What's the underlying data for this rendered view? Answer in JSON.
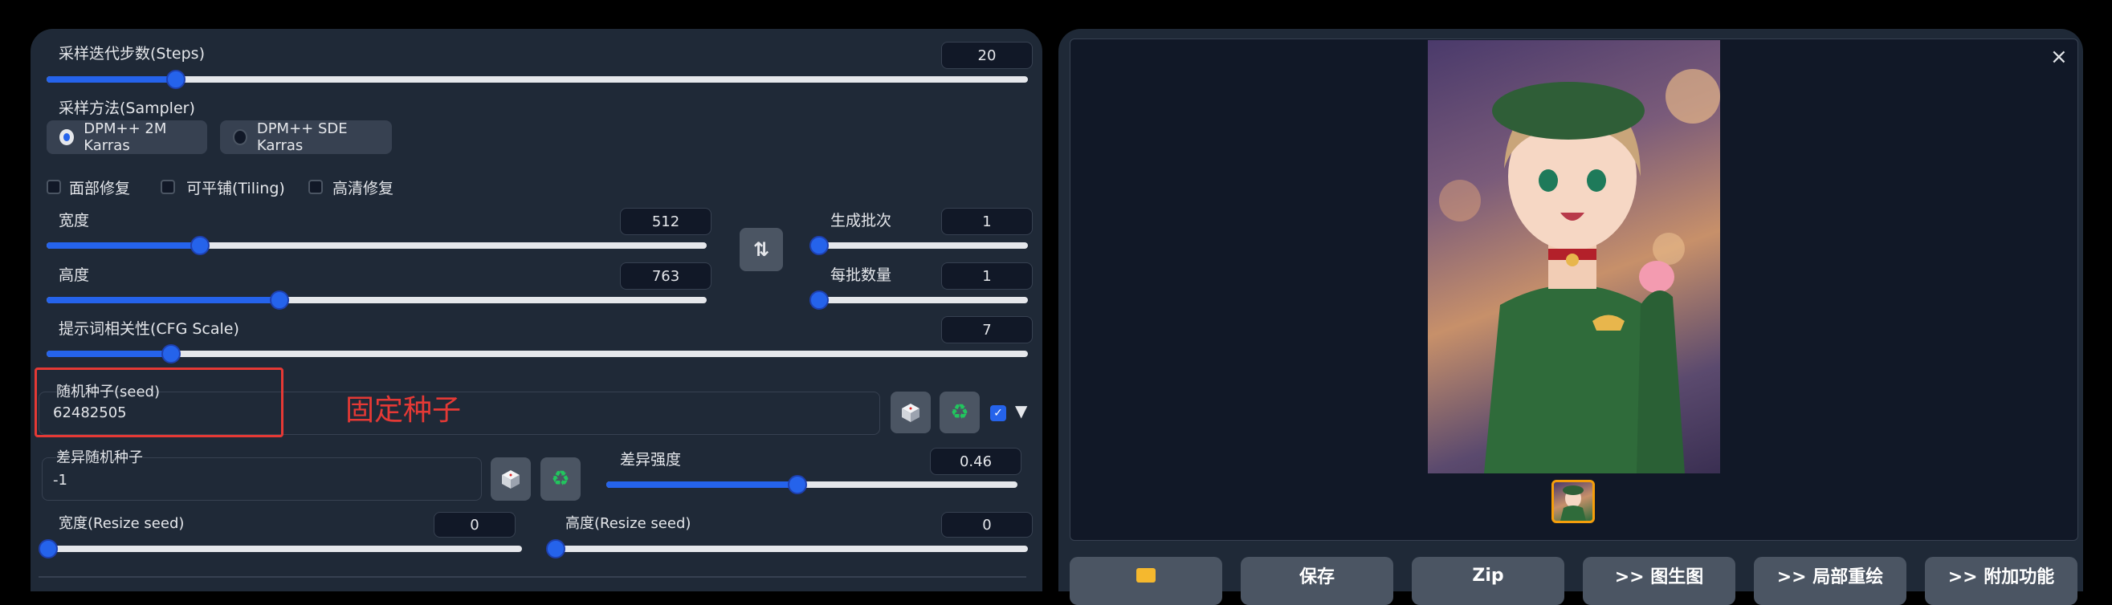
{
  "sliders": {
    "steps": {
      "label": "采样迭代步数(Steps)",
      "value": "20",
      "progress": 0.13
    },
    "width": {
      "label": "宽度",
      "value": "512",
      "progress": 0.23
    },
    "height": {
      "label": "高度",
      "value": "763",
      "progress": 0.35
    },
    "batch_count": {
      "label": "生成批次",
      "value": "1",
      "progress": 0.0
    },
    "batch_size": {
      "label": "每批数量",
      "value": "1",
      "progress": 0.0
    },
    "cfg": {
      "label": "提示词相关性(CFG Scale)",
      "value": "7",
      "progress": 0.2
    },
    "variation_strength": {
      "label": "差异强度",
      "value": "0.46",
      "progress": 0.46
    },
    "resize_width": {
      "label": "宽度(Resize seed)",
      "value": "0",
      "progress": 0.0
    },
    "resize_height": {
      "label": "高度(Resize seed)",
      "value": "0",
      "progress": 0.0
    }
  },
  "sampler": {
    "label": "采样方法(Sampler)",
    "options": [
      "DPM++ 2M Karras",
      "DPM++ SDE Karras"
    ],
    "selected": "DPM++ 2M Karras"
  },
  "checkboxes": {
    "face_restore": "面部修复",
    "tiling": "可平铺(Tiling)",
    "hires_fix": "高清修复"
  },
  "seed": {
    "label": "随机种子(seed)",
    "value": "62482505",
    "annotation": "固定种子"
  },
  "variation_seed": {
    "label": "差异随机种子",
    "value": "-1"
  },
  "output": {
    "close": "×",
    "buttons": [
      "保存",
      "Zip",
      ">> 图生图",
      ">> 局部重绘",
      ">> 附加功能"
    ]
  },
  "colors": {
    "accent": "#2563eb",
    "panel": "#1f2937",
    "annotation": "#e53935"
  },
  "icons": [
    "swap-icon",
    "dice-icon",
    "recycle-icon",
    "folder-icon",
    "close-icon"
  ]
}
